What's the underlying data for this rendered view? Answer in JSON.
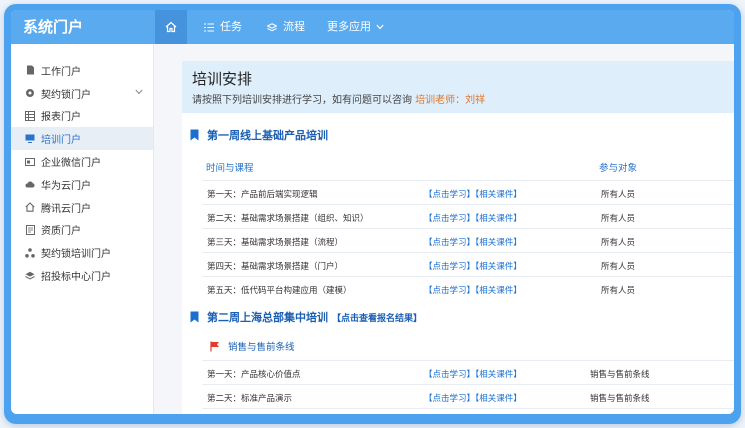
{
  "app": {
    "title": "系统门户"
  },
  "nav": {
    "items": [
      {
        "label": "任务",
        "icon": "list-icon"
      },
      {
        "label": "流程",
        "icon": "layers-icon"
      },
      {
        "label": "更多应用",
        "icon": "chevron-down-icon"
      }
    ]
  },
  "sidebar": {
    "items": [
      {
        "label": "工作门户",
        "icon": "document-icon",
        "active": false,
        "expandable": false
      },
      {
        "label": "契约锁门户",
        "icon": "gear-icon",
        "active": false,
        "expandable": true
      },
      {
        "label": "报表门户",
        "icon": "table-icon",
        "active": false,
        "expandable": false
      },
      {
        "label": "培训门户",
        "icon": "monitor-icon",
        "active": true,
        "expandable": false
      },
      {
        "label": "企业微信门户",
        "icon": "card-icon",
        "active": false,
        "expandable": false
      },
      {
        "label": "华为云门户",
        "icon": "cloud-icon",
        "active": false,
        "expandable": false
      },
      {
        "label": "腾讯云门户",
        "icon": "home-icon",
        "active": false,
        "expandable": false
      },
      {
        "label": "资质门户",
        "icon": "document-icon",
        "active": false,
        "expandable": false
      },
      {
        "label": "契约锁培训门户",
        "icon": "nodes-icon",
        "active": false,
        "expandable": false
      },
      {
        "label": "招投标中心门户",
        "icon": "stack-icon",
        "active": false,
        "expandable": false
      }
    ]
  },
  "main": {
    "title": "培训安排",
    "notice": "请按照下列培训安排进行学习，如有问题可以咨询",
    "teacher": "培训老师：刘祥",
    "week1": {
      "title": "第一周线上基础产品培训",
      "col_time": "时间与课程",
      "col_audience": "参与对象",
      "rows": [
        {
          "day": "第一天：产品前后端实现逻辑",
          "study": "【点击学习】",
          "course": "【相关课件】",
          "audience": "所有人员"
        },
        {
          "day": "第二天：基础需求场景搭建（组织、知识）",
          "study": "【点击学习】",
          "course": "【相关课件】",
          "audience": "所有人员"
        },
        {
          "day": "第三天：基础需求场景搭建（流程）",
          "study": "【点击学习】",
          "course": "【相关课件】",
          "audience": "所有人员"
        },
        {
          "day": "第四天：基础需求场景搭建（门户）",
          "study": "【点击学习】",
          "course": "【相关课件】",
          "audience": "所有人员"
        },
        {
          "day": "第五天：低代码平台构建应用（建模）",
          "study": "【点击学习】",
          "course": "【相关课件】",
          "audience": "所有人员"
        }
      ]
    },
    "week2": {
      "title": "第二周上海总部集中培训",
      "report_link": "【点击查看报名结果】",
      "subsection": "销售与售前条线",
      "rows": [
        {
          "day": "第一天：产品核心价值点",
          "study": "【点击学习】",
          "course": "【相关课件】",
          "audience": "销售与售前条线"
        },
        {
          "day": "第二天：标准产品演示",
          "study": "【点击学习】",
          "course": "【相关课件】",
          "audience": "销售与售前条线"
        }
      ]
    }
  },
  "colors": {
    "topbar": "#5aaaf0",
    "accent": "#1a6fd1",
    "teacher": "#e0762a",
    "flag": "#e23b2e"
  }
}
